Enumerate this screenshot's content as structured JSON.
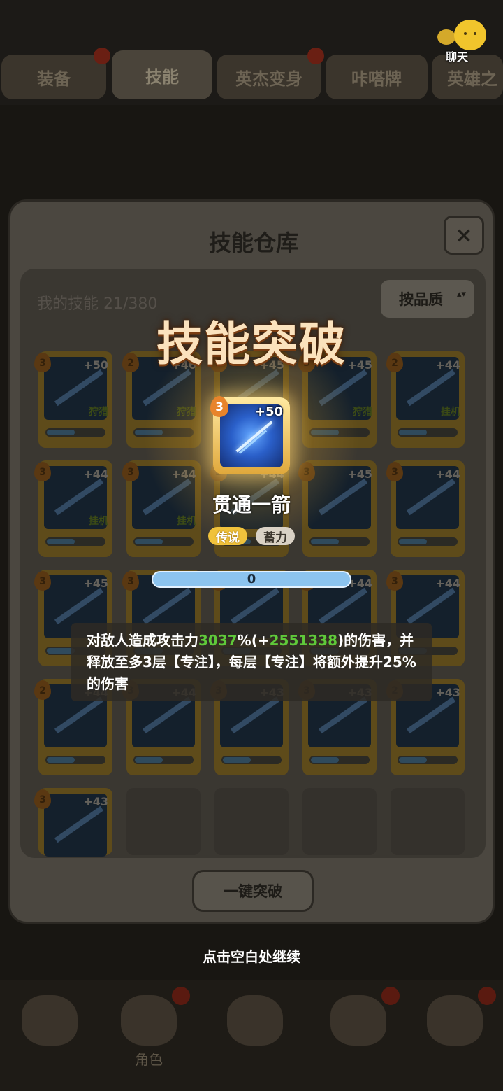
{
  "top_tabs": [
    {
      "label": "装备"
    },
    {
      "label": "技能"
    },
    {
      "label": "英杰变身"
    },
    {
      "label": "咔嗒牌"
    },
    {
      "label": "英雄之"
    }
  ],
  "chat": {
    "label": "聊天"
  },
  "panel": {
    "title": "技能仓库",
    "close_icon": "×",
    "count_label": "我的技能 21/380",
    "sort_label": "按品质",
    "sort_caret": "▴▾",
    "one_click_label": "一键突破"
  },
  "cards": [
    {
      "level": "3",
      "plus": "+50",
      "tag": "狩猎"
    },
    {
      "level": "2",
      "plus": "+46",
      "tag": "狩猎"
    },
    {
      "level": "3",
      "plus": "+45",
      "tag": ""
    },
    {
      "level": "3",
      "plus": "+45",
      "tag": "狩猎"
    },
    {
      "level": "2",
      "plus": "+44",
      "tag": "挂机"
    },
    {
      "level": "3",
      "plus": "+44",
      "tag": "挂机"
    },
    {
      "level": "3",
      "plus": "+44",
      "tag": "挂机"
    },
    {
      "level": "3",
      "plus": "+44",
      "tag": ""
    },
    {
      "level": "3",
      "plus": "+45",
      "tag": ""
    },
    {
      "level": "3",
      "plus": "+44",
      "tag": ""
    },
    {
      "level": "3",
      "plus": "+45",
      "tag": ""
    },
    {
      "level": "3",
      "plus": "+44",
      "tag": ""
    },
    {
      "level": "3",
      "plus": "+44",
      "tag": ""
    },
    {
      "level": "3",
      "plus": "+44",
      "tag": ""
    },
    {
      "level": "3",
      "plus": "+44",
      "tag": ""
    },
    {
      "level": "2",
      "plus": "+44",
      "tag": ""
    },
    {
      "level": "3",
      "plus": "+44",
      "tag": ""
    },
    {
      "level": "3",
      "plus": "+43",
      "tag": ""
    },
    {
      "level": "3",
      "plus": "+43",
      "tag": ""
    },
    {
      "level": "2",
      "plus": "+43",
      "tag": ""
    },
    {
      "level": "3",
      "plus": "+43",
      "tag": ""
    }
  ],
  "breakthrough": {
    "title": "技能突破",
    "skill_level": "3",
    "skill_plus": "+50",
    "skill_name": "贯通一箭",
    "rarity_badge": "传说",
    "type_badge": "蓄力",
    "progress_value": "0",
    "desc_prefix": "对敌人造成攻击力",
    "desc_pct": "3037",
    "desc_mid": "%(+",
    "desc_bonus": "2551338",
    "desc_suffix": ")的伤害，并释放至多3层【专注】，每层【专注】将额外提升25%的伤害"
  },
  "bottom_nav": [
    {
      "label": ""
    },
    {
      "label": "角色"
    },
    {
      "label": ""
    },
    {
      "label": ""
    },
    {
      "label": ""
    }
  ],
  "continue_hint": "点击空白处继续",
  "colors": {
    "accent_gold": "#f0c23c",
    "bonus_green": "#5fc93a",
    "progress_blue": "#8cc4ef"
  }
}
